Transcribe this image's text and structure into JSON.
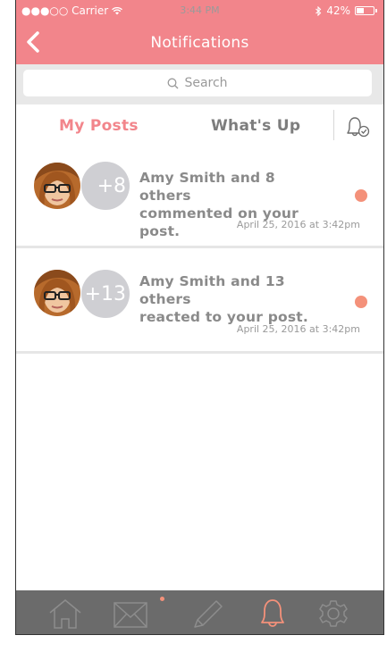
{
  "status_bar": {
    "carrier": "●●●○○ Carrier",
    "time": "3:44 PM",
    "battery": "42%"
  },
  "nav": {
    "title": "Notifications",
    "back_icon": "chevron-left-icon"
  },
  "search": {
    "placeholder": "Search",
    "icon": "search-icon"
  },
  "tabs": {
    "my_posts": "My Posts",
    "whats_up": "What's Up",
    "bell_icon": "bell-check-icon"
  },
  "notifications": [
    {
      "badge": "+8",
      "line1": "Amy Smith and 8 others",
      "line2": "commented on your post.",
      "timestamp": "April 25, 2016 at 3:42pm",
      "unread": true
    },
    {
      "badge": "+13",
      "line1": "Amy Smith and 13 others",
      "line2": "reacted to your post.",
      "timestamp": "April 25, 2016 at 3:42pm",
      "unread": true
    }
  ],
  "tab_bar": {
    "items": [
      "home-icon",
      "mail-icon",
      "pencil-icon",
      "bell-icon",
      "gear-icon"
    ],
    "active": "bell-icon"
  },
  "colors": {
    "accent": "#f2858b",
    "unread_dot": "#f4917a",
    "tabbar": "#6b6b6b"
  }
}
